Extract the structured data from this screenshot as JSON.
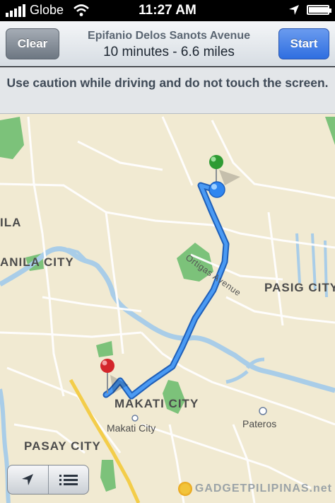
{
  "status_bar": {
    "carrier": "Globe",
    "time": "11:27 AM"
  },
  "nav_bar": {
    "clear_label": "Clear",
    "start_label": "Start",
    "destination": "Epifanio Delos Sanots Avenue",
    "summary": "10 minutes - 6.6 miles"
  },
  "banner": {
    "message": "Use caution while driving and do not touch the screen."
  },
  "map": {
    "labels": {
      "ila": "ILA",
      "manila_city": "ANILA CITY",
      "ortigas_avenue": "Ortigas Avenue",
      "pasig_city": "PASIG CITY",
      "makati_city_big": "MAKATI CITY",
      "makati_city_small": "Makati City",
      "pateros": "Pateros",
      "pasay_city": "PASAY CITY"
    },
    "colors": {
      "land": "#f1ead2",
      "road_minor": "#ffffff",
      "road_major": "#f3cd4a",
      "water": "#a9cde8",
      "park": "#7cc27a",
      "route": "#2d7de6",
      "start_pin": "#2e9b33",
      "end_pin": "#d3262b",
      "current_location": "#2f86f0"
    }
  },
  "controls": {
    "locate_icon": "location-arrow-icon",
    "list_icon": "list-icon"
  },
  "watermark": {
    "text": "GADGETPILIPINAS.net"
  }
}
